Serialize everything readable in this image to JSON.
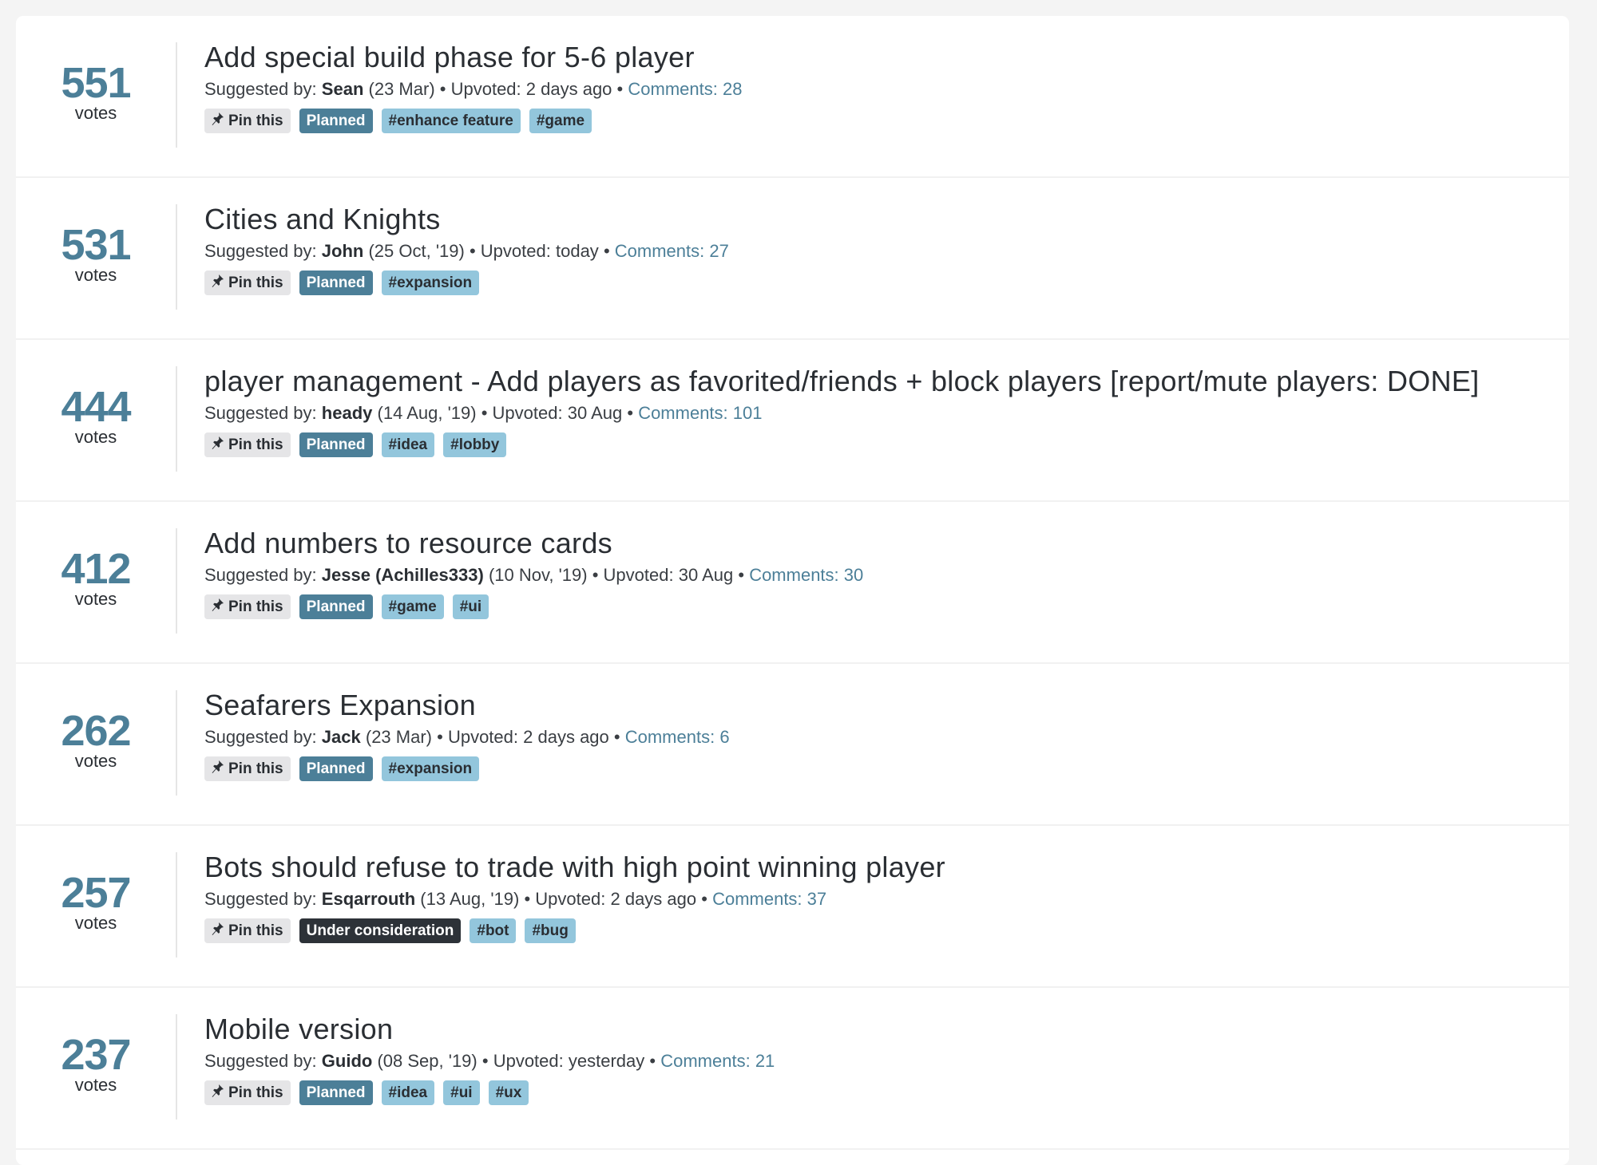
{
  "colors": {
    "accent": "#4c7f98",
    "planned_bg": "#4c7f98",
    "under_consideration_bg": "#2d3238",
    "hashtag_bg": "#93c6dc",
    "pin_bg": "#e5e5e7",
    "page_bg": "#f4f4f4"
  },
  "labels": {
    "votes": "votes",
    "suggested_by": "Suggested by:",
    "upvoted": "Upvoted:",
    "comments": "Comments:",
    "pin": "Pin this",
    "separator": "•"
  },
  "icons": {
    "pin": "pushpin-icon"
  },
  "suggestions": [
    {
      "votes": "551",
      "title": "Add special build phase for 5-6 player",
      "author": "Sean",
      "date": "(23 Mar)",
      "upvoted": "2 days ago",
      "comments": "Comments: 28",
      "status": "Planned",
      "status_kind": "planned",
      "tags": [
        "#enhance feature",
        "#game"
      ]
    },
    {
      "votes": "531",
      "title": "Cities and Knights",
      "author": "John",
      "date": "(25 Oct, '19)",
      "upvoted": "today",
      "comments": "Comments: 27",
      "status": "Planned",
      "status_kind": "planned",
      "tags": [
        "#expansion"
      ]
    },
    {
      "votes": "444",
      "title": "player management - Add players as favorited/friends + block players [report/mute players: DONE]",
      "author": "heady",
      "date": "(14 Aug, '19)",
      "upvoted": "30 Aug",
      "comments": "Comments: 101",
      "status": "Planned",
      "status_kind": "planned",
      "tags": [
        "#idea",
        "#lobby"
      ]
    },
    {
      "votes": "412",
      "title": "Add numbers to resource cards",
      "author": "Jesse (Achilles333)",
      "date": "(10 Nov, '19)",
      "upvoted": "30 Aug",
      "comments": "Comments: 30",
      "status": "Planned",
      "status_kind": "planned",
      "tags": [
        "#game",
        "#ui"
      ]
    },
    {
      "votes": "262",
      "title": "Seafarers Expansion",
      "author": "Jack",
      "date": "(23 Mar)",
      "upvoted": "2 days ago",
      "comments": "Comments: 6",
      "status": "Planned",
      "status_kind": "planned",
      "tags": [
        "#expansion"
      ]
    },
    {
      "votes": "257",
      "title": "Bots should refuse to trade with high point winning player",
      "author": "Esqarrouth",
      "date": "(13 Aug, '19)",
      "upvoted": "2 days ago",
      "comments": "Comments: 37",
      "status": "Under consideration",
      "status_kind": "consideration",
      "tags": [
        "#bot",
        "#bug"
      ]
    },
    {
      "votes": "237",
      "title": "Mobile version",
      "author": "Guido",
      "date": "(08 Sep, '19)",
      "upvoted": "yesterday",
      "comments": "Comments: 21",
      "status": "Planned",
      "status_kind": "planned",
      "tags": [
        "#idea",
        "#ui",
        "#ux"
      ]
    }
  ]
}
